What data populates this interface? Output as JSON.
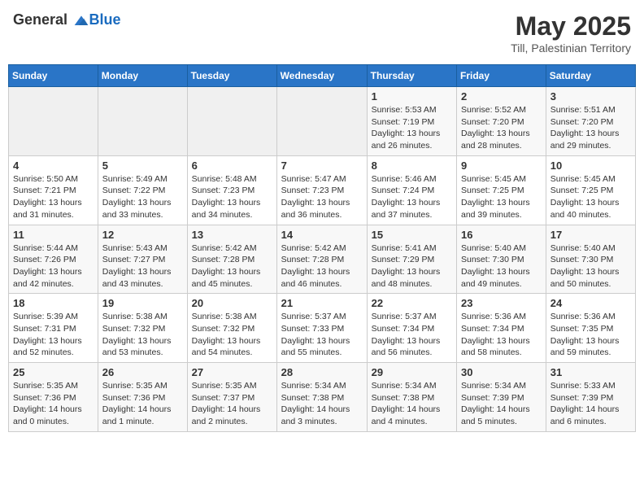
{
  "header": {
    "logo_general": "General",
    "logo_blue": "Blue",
    "month_title": "May 2025",
    "location": "Till, Palestinian Territory"
  },
  "days_of_week": [
    "Sunday",
    "Monday",
    "Tuesday",
    "Wednesday",
    "Thursday",
    "Friday",
    "Saturday"
  ],
  "weeks": [
    [
      {
        "num": "",
        "info": ""
      },
      {
        "num": "",
        "info": ""
      },
      {
        "num": "",
        "info": ""
      },
      {
        "num": "",
        "info": ""
      },
      {
        "num": "1",
        "info": "Sunrise: 5:53 AM\nSunset: 7:19 PM\nDaylight: 13 hours\nand 26 minutes."
      },
      {
        "num": "2",
        "info": "Sunrise: 5:52 AM\nSunset: 7:20 PM\nDaylight: 13 hours\nand 28 minutes."
      },
      {
        "num": "3",
        "info": "Sunrise: 5:51 AM\nSunset: 7:20 PM\nDaylight: 13 hours\nand 29 minutes."
      }
    ],
    [
      {
        "num": "4",
        "info": "Sunrise: 5:50 AM\nSunset: 7:21 PM\nDaylight: 13 hours\nand 31 minutes."
      },
      {
        "num": "5",
        "info": "Sunrise: 5:49 AM\nSunset: 7:22 PM\nDaylight: 13 hours\nand 33 minutes."
      },
      {
        "num": "6",
        "info": "Sunrise: 5:48 AM\nSunset: 7:23 PM\nDaylight: 13 hours\nand 34 minutes."
      },
      {
        "num": "7",
        "info": "Sunrise: 5:47 AM\nSunset: 7:23 PM\nDaylight: 13 hours\nand 36 minutes."
      },
      {
        "num": "8",
        "info": "Sunrise: 5:46 AM\nSunset: 7:24 PM\nDaylight: 13 hours\nand 37 minutes."
      },
      {
        "num": "9",
        "info": "Sunrise: 5:45 AM\nSunset: 7:25 PM\nDaylight: 13 hours\nand 39 minutes."
      },
      {
        "num": "10",
        "info": "Sunrise: 5:45 AM\nSunset: 7:25 PM\nDaylight: 13 hours\nand 40 minutes."
      }
    ],
    [
      {
        "num": "11",
        "info": "Sunrise: 5:44 AM\nSunset: 7:26 PM\nDaylight: 13 hours\nand 42 minutes."
      },
      {
        "num": "12",
        "info": "Sunrise: 5:43 AM\nSunset: 7:27 PM\nDaylight: 13 hours\nand 43 minutes."
      },
      {
        "num": "13",
        "info": "Sunrise: 5:42 AM\nSunset: 7:28 PM\nDaylight: 13 hours\nand 45 minutes."
      },
      {
        "num": "14",
        "info": "Sunrise: 5:42 AM\nSunset: 7:28 PM\nDaylight: 13 hours\nand 46 minutes."
      },
      {
        "num": "15",
        "info": "Sunrise: 5:41 AM\nSunset: 7:29 PM\nDaylight: 13 hours\nand 48 minutes."
      },
      {
        "num": "16",
        "info": "Sunrise: 5:40 AM\nSunset: 7:30 PM\nDaylight: 13 hours\nand 49 minutes."
      },
      {
        "num": "17",
        "info": "Sunrise: 5:40 AM\nSunset: 7:30 PM\nDaylight: 13 hours\nand 50 minutes."
      }
    ],
    [
      {
        "num": "18",
        "info": "Sunrise: 5:39 AM\nSunset: 7:31 PM\nDaylight: 13 hours\nand 52 minutes."
      },
      {
        "num": "19",
        "info": "Sunrise: 5:38 AM\nSunset: 7:32 PM\nDaylight: 13 hours\nand 53 minutes."
      },
      {
        "num": "20",
        "info": "Sunrise: 5:38 AM\nSunset: 7:32 PM\nDaylight: 13 hours\nand 54 minutes."
      },
      {
        "num": "21",
        "info": "Sunrise: 5:37 AM\nSunset: 7:33 PM\nDaylight: 13 hours\nand 55 minutes."
      },
      {
        "num": "22",
        "info": "Sunrise: 5:37 AM\nSunset: 7:34 PM\nDaylight: 13 hours\nand 56 minutes."
      },
      {
        "num": "23",
        "info": "Sunrise: 5:36 AM\nSunset: 7:34 PM\nDaylight: 13 hours\nand 58 minutes."
      },
      {
        "num": "24",
        "info": "Sunrise: 5:36 AM\nSunset: 7:35 PM\nDaylight: 13 hours\nand 59 minutes."
      }
    ],
    [
      {
        "num": "25",
        "info": "Sunrise: 5:35 AM\nSunset: 7:36 PM\nDaylight: 14 hours\nand 0 minutes."
      },
      {
        "num": "26",
        "info": "Sunrise: 5:35 AM\nSunset: 7:36 PM\nDaylight: 14 hours\nand 1 minute."
      },
      {
        "num": "27",
        "info": "Sunrise: 5:35 AM\nSunset: 7:37 PM\nDaylight: 14 hours\nand 2 minutes."
      },
      {
        "num": "28",
        "info": "Sunrise: 5:34 AM\nSunset: 7:38 PM\nDaylight: 14 hours\nand 3 minutes."
      },
      {
        "num": "29",
        "info": "Sunrise: 5:34 AM\nSunset: 7:38 PM\nDaylight: 14 hours\nand 4 minutes."
      },
      {
        "num": "30",
        "info": "Sunrise: 5:34 AM\nSunset: 7:39 PM\nDaylight: 14 hours\nand 5 minutes."
      },
      {
        "num": "31",
        "info": "Sunrise: 5:33 AM\nSunset: 7:39 PM\nDaylight: 14 hours\nand 6 minutes."
      }
    ]
  ]
}
